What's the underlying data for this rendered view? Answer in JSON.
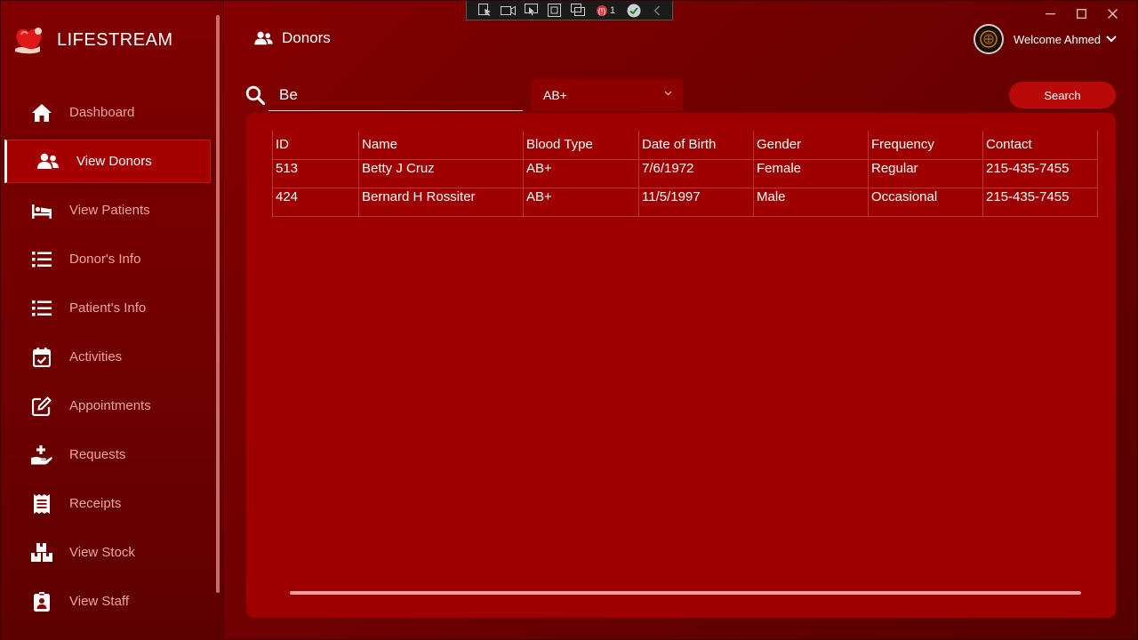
{
  "app": {
    "title": "LIFESTREAM"
  },
  "sidebar": {
    "items": [
      {
        "label": "Dashboard",
        "icon": "home-icon"
      },
      {
        "label": "View Donors",
        "icon": "users-icon",
        "active": true
      },
      {
        "label": "View Patients",
        "icon": "bed-icon"
      },
      {
        "label": "Donor's Info",
        "icon": "list-icon"
      },
      {
        "label": "Patient's Info",
        "icon": "list-icon"
      },
      {
        "label": "Activities",
        "icon": "calendar-check-icon"
      },
      {
        "label": "Appointments",
        "icon": "edit-icon"
      },
      {
        "label": "Requests",
        "icon": "hand-plus-icon"
      },
      {
        "label": "Receipts",
        "icon": "receipt-icon"
      },
      {
        "label": "View Stock",
        "icon": "boxes-icon"
      },
      {
        "label": "View Staff",
        "icon": "id-badge-icon"
      }
    ]
  },
  "header": {
    "title": "Donors",
    "welcome": "Welcome Ahmed"
  },
  "search": {
    "value": "Be",
    "blood_type": "AB+",
    "button": "Search"
  },
  "table": {
    "columns": [
      "ID",
      "Name",
      "Blood Type",
      "Date of Birth",
      "Gender",
      "Frequency",
      "Contact"
    ],
    "rows": [
      [
        "513",
        "Betty J Cruz",
        "AB+",
        "7/6/1972",
        "Female",
        "Regular",
        "215-435-7455"
      ],
      [
        "424",
        "Bernard H Rossiter",
        "AB+",
        "11/5/1997",
        "Male",
        "Occasional",
        "215-435-7455"
      ]
    ]
  },
  "debug_toolbar": {
    "counter": "1"
  },
  "colors": {
    "accent": "#9e0000",
    "sidebar": "#700000",
    "button": "#b90a0a",
    "muted_text": "#f0a2a2"
  }
}
